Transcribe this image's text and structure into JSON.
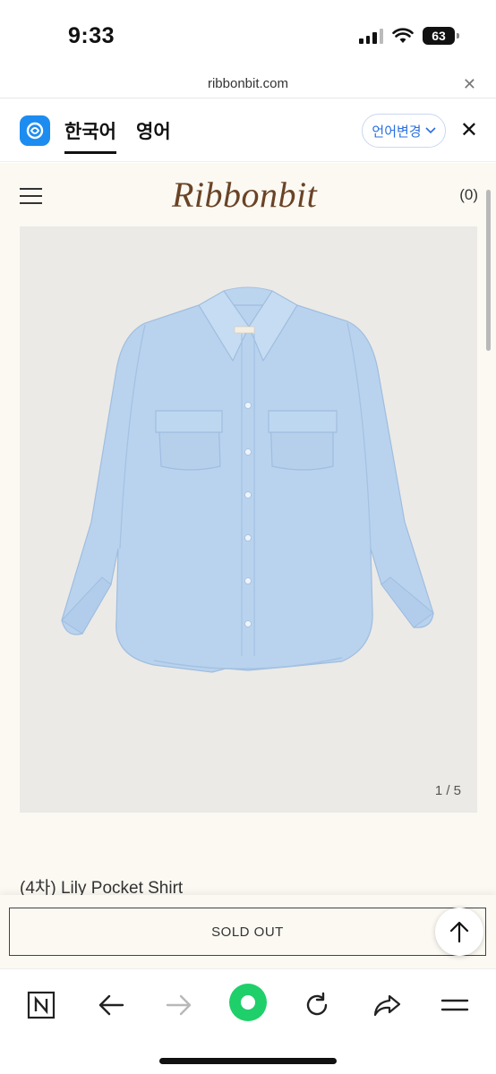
{
  "status_bar": {
    "time": "9:33",
    "battery": "63",
    "icons": [
      "signal-icon",
      "wifi-icon",
      "battery-icon"
    ]
  },
  "browser": {
    "url": "ribbonbit.com"
  },
  "translate_bar": {
    "tabs": [
      "한국어",
      "영어"
    ],
    "active_tab": "한국어",
    "change_language_label": "언어변경",
    "icons": [
      "papago-icon",
      "chevron-down-icon",
      "close-icon"
    ]
  },
  "site": {
    "logo": "Ribbonbit",
    "cart_count": "(0)",
    "product": {
      "image_counter": "1 / 5",
      "name": "(4차) Lily Pocket Shirt",
      "status_label": "SOLD OUT"
    }
  },
  "toolbar": {
    "buttons": [
      "naver-home-icon",
      "back-icon",
      "forward-icon",
      "green-dot-icon",
      "reload-icon",
      "share-icon",
      "menu-icon"
    ]
  },
  "colors": {
    "page_bg": "#fbf9f2",
    "image_bg": "#eceae6",
    "shirt": "#b9d3ee",
    "logo": "#6a4326",
    "accent_blue": "#2a6fe0",
    "green": "#1fcf6a"
  }
}
